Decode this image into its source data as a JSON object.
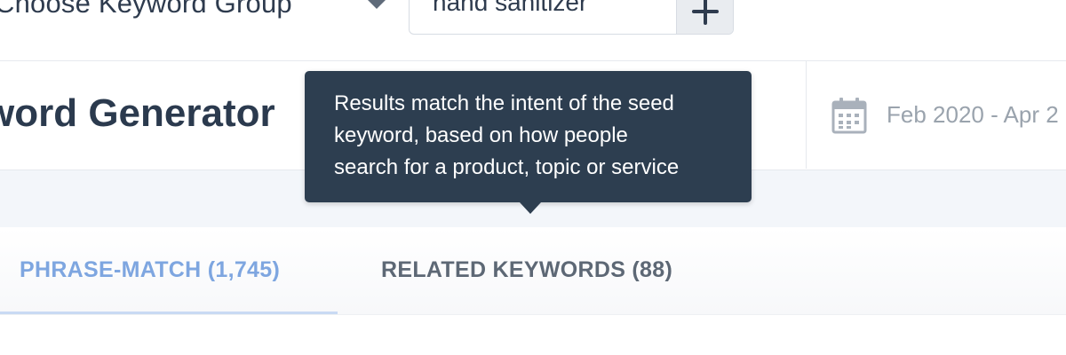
{
  "topbar": {
    "group_label": "Choose Keyword Group",
    "keyword_value": "hand sanitizer",
    "add_icon": "plus-icon",
    "caret_icon": "chevron-down-icon"
  },
  "header": {
    "title": "word Generator",
    "date_range": "Feb 2020 - Apr 2",
    "calendar_icon": "calendar-icon"
  },
  "tooltip": {
    "lines": [
      "Results match the intent of the seed",
      "keyword, based on how people",
      "search for a product, topic or service"
    ]
  },
  "tabs": [
    {
      "label": "PHRASE-MATCH (1,745)",
      "active": true
    },
    {
      "label": "RELATED KEYWORDS (88)",
      "active": false
    }
  ],
  "colors": {
    "tooltip_bg": "#2d3e50",
    "active_tab": "#7ea6e0",
    "inactive_tab": "#5d6875",
    "title": "#2b3a4e",
    "muted": "#9aa3ad"
  }
}
